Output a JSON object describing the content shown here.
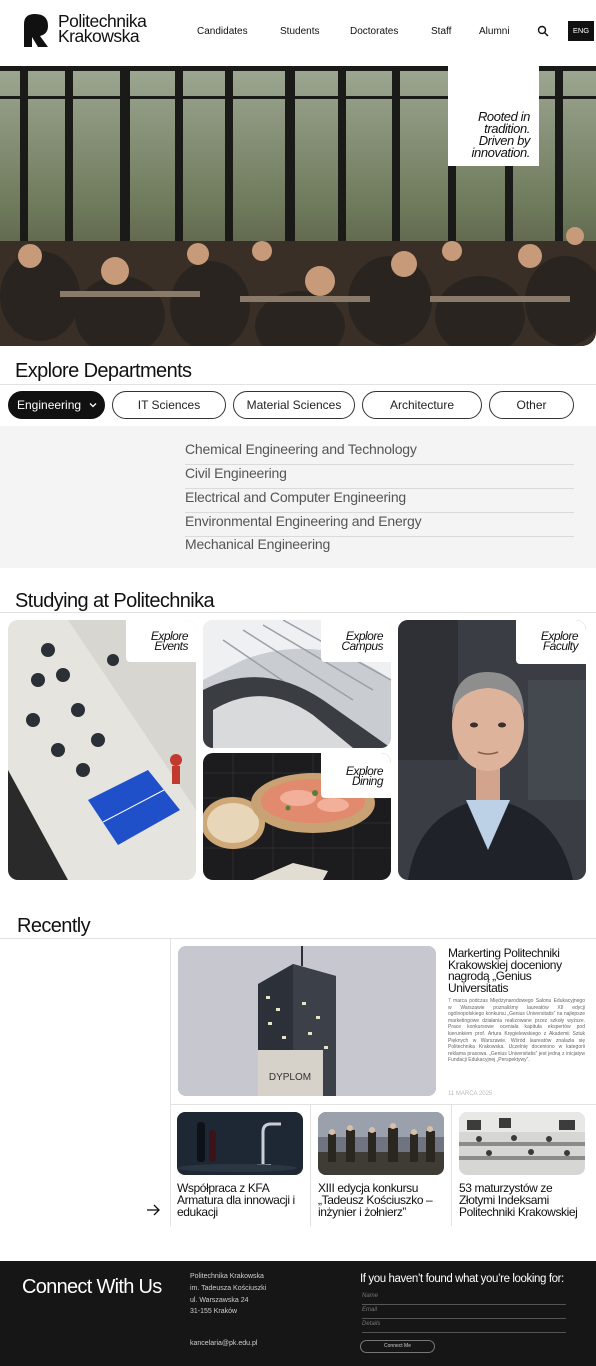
{
  "header": {
    "logo_line1": "Politechnika",
    "logo_line2": "Krakowska",
    "nav": [
      "Candidates",
      "Students",
      "Doctorates",
      "Staff",
      "Alumni"
    ],
    "lang": "ENG"
  },
  "hero": {
    "tagline": "Rooted in tradition. Driven by innovation."
  },
  "departments": {
    "title": "Explore Departments",
    "filters": [
      "Engineering",
      "IT Sciences",
      "Material Sciences",
      "Architecture",
      "Other"
    ],
    "active_filter": "Engineering",
    "items": [
      "Chemical Engineering and Technology",
      "Civil Engineering",
      "Electrical and Computer Engineering",
      "Environmental Engineering and Energy",
      "Mechanical Engineering"
    ]
  },
  "studying": {
    "title": "Studying at Politechnika",
    "cards": [
      {
        "line1": "Explore",
        "line2": "Events"
      },
      {
        "line1": "Explore",
        "line2": "Campus"
      },
      {
        "line1": "Explore",
        "line2": "Dining"
      },
      {
        "line1": "Explore",
        "line2": "Faculty"
      }
    ]
  },
  "recently": {
    "title": "Recently",
    "main": {
      "title": "Markerting Politechniki Krakowskiej doceniony nagrodą „Genius Universitatis",
      "body": "7 marca podczas Międzynarodowego Salonu Edukacyjnego w Warszawie poznaliśmy laureatów XII edycji ogólnopolskiego konkursu „Genius Universitatis” na najlepsze marketingowe działania realizowane przez szkoły wyższe. Prace konkursowe oceniała kapituła ekspertów pod kierunkiem prof. Artura Kręgielewskiego z Akademii Sztuk Pięknych w Warszawie. Wśród laureatów znalazła się Politechnika Krakowska. Uczelnię doceniono w kategorii reklama prasowa. „Genius Universitatis” jest jedną z inicjatyw Fundacji Edukacyjnej „Perspektywy”.",
      "date": "11 MARCA 2025",
      "sign_text": "DYPLOM"
    },
    "cards": [
      {
        "title": "Współpraca z KFA Armatura dla innowacji i edukacji"
      },
      {
        "title": "XIII edycja konkursu „Tadeusz Kościuszko – inżynier i żołnierz”"
      },
      {
        "title": "53 maturzystów ze Złotymi Indeksami Politechniki Krakowskiej"
      }
    ]
  },
  "footer": {
    "title": "Connect With Us",
    "address": [
      "Politechnika Krakowska",
      "im. Tadeusza Kościuszki",
      "ul. Warszawska 24",
      "31-155 Kraków"
    ],
    "email": "kancelaria@pk.edu.pl",
    "question": "If you haven’t found what you’re looking for:",
    "fields": [
      "Name",
      "Email",
      "Details"
    ],
    "button": "Connect Me"
  },
  "colors": {
    "dark": "#111111",
    "panel": "#f4f4f4",
    "footer": "#161616"
  }
}
